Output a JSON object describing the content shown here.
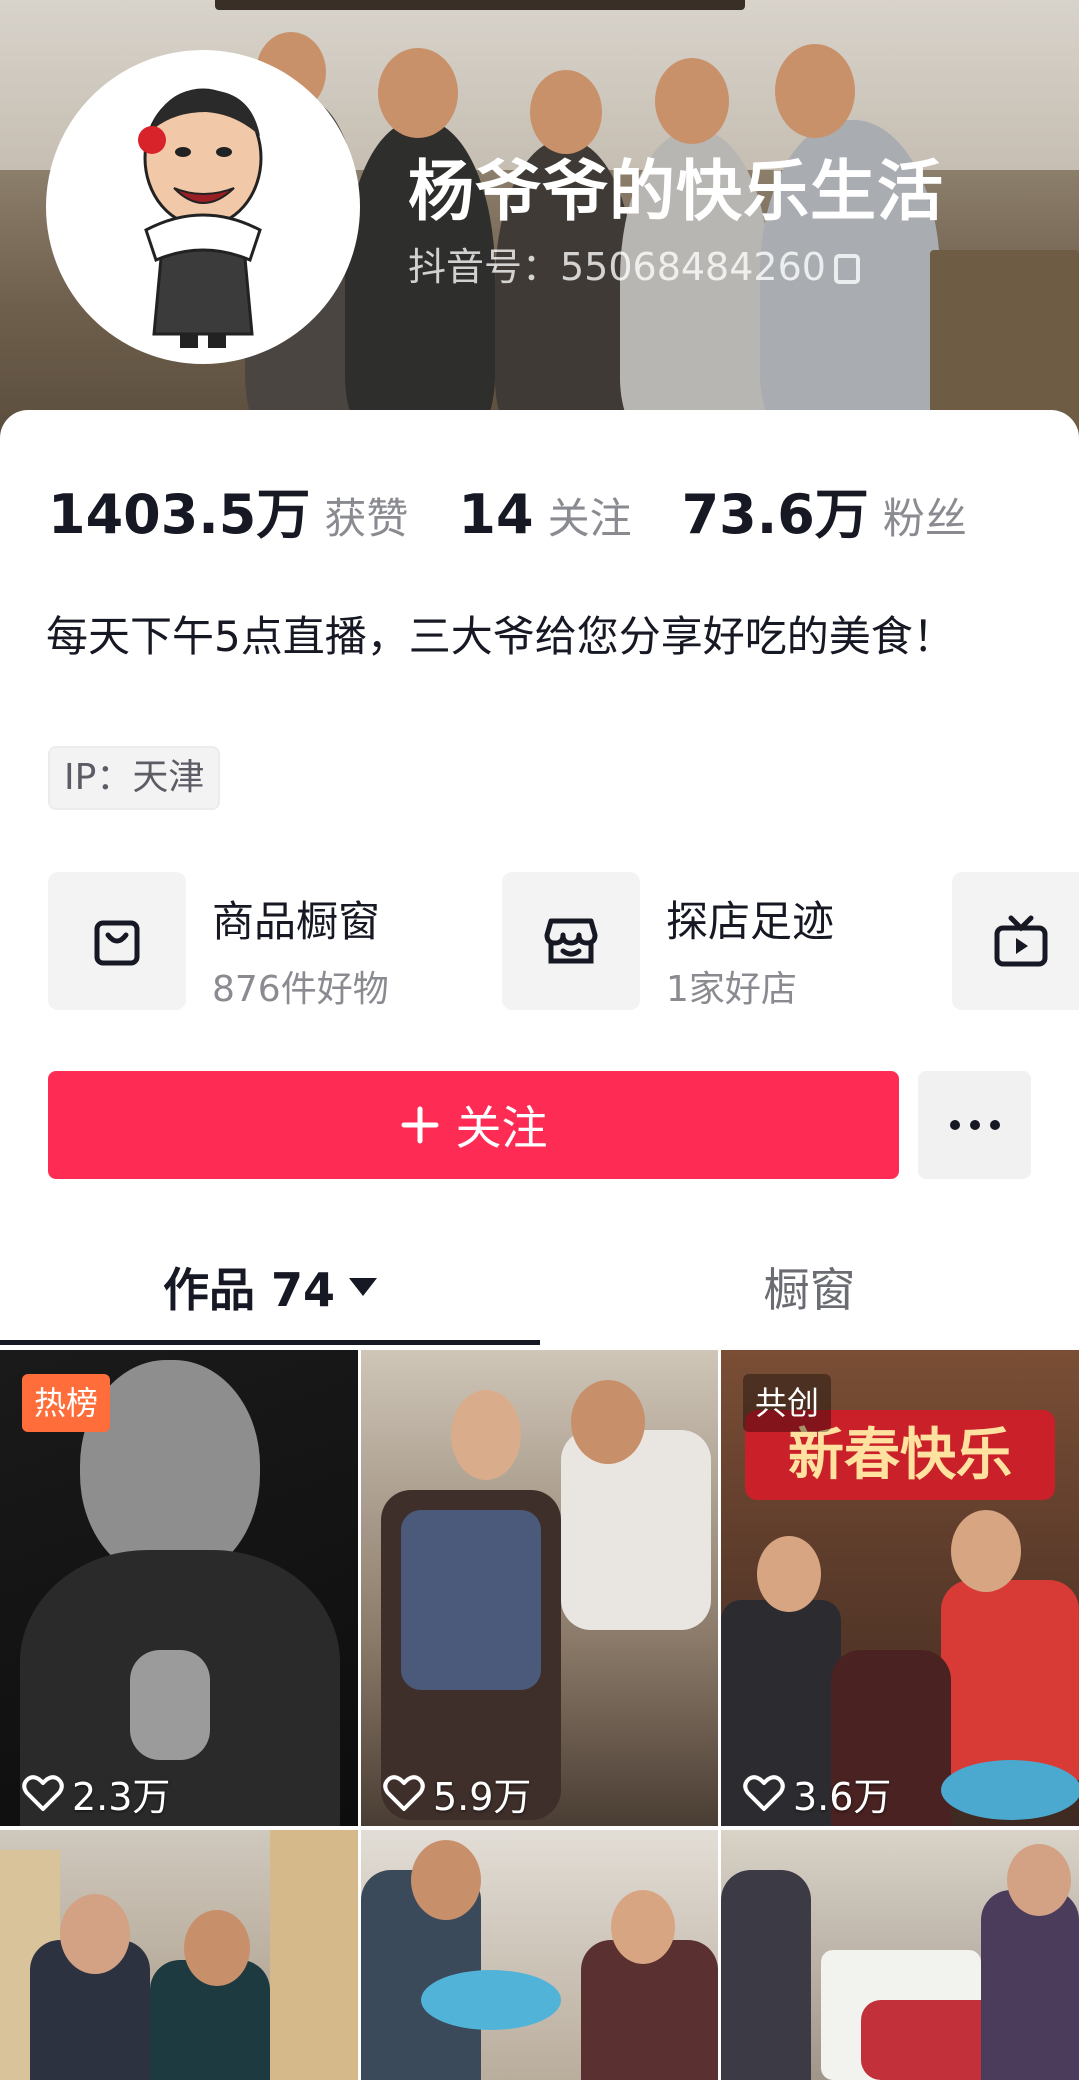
{
  "profile": {
    "name": "杨爷爷的快乐生活",
    "douyin_id": "抖音号：55068484260",
    "stats": [
      {
        "value": "1403.5万",
        "label": "获赞"
      },
      {
        "value": "14",
        "label": "关注"
      },
      {
        "value": "73.6万",
        "label": "粉丝"
      }
    ],
    "bio": "每天下午5点直播，三大爷给您分享好吃的美食！",
    "ip": "IP：天津"
  },
  "entries": [
    {
      "title": "商品橱窗",
      "subtitle": "876件好物",
      "icon": "shopping-bag-icon"
    },
    {
      "title": "探店足迹",
      "subtitle": "1家好店",
      "icon": "store-icon"
    },
    {
      "title": "",
      "subtitle": "",
      "icon": "tv-icon"
    }
  ],
  "actions": {
    "follow_label": "关注"
  },
  "tabs": {
    "works": "作品 74",
    "shop": "橱窗"
  },
  "videos": [
    {
      "likes": "2.3万",
      "badge": "热榜"
    },
    {
      "likes": "5.9万",
      "badge": ""
    },
    {
      "likes": "3.6万",
      "badge": "共创",
      "overlay_text": "新春快乐"
    },
    {
      "likes": "",
      "badge": ""
    },
    {
      "likes": "",
      "badge": ""
    },
    {
      "likes": "",
      "badge": ""
    }
  ],
  "colors": {
    "accent": "#fe2c55",
    "hot_badge": "#fe6d3a"
  }
}
